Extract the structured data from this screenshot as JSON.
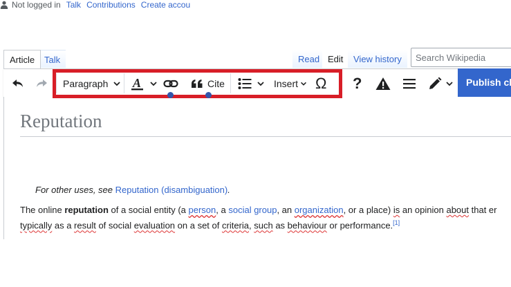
{
  "personal_tools": {
    "status": "Not logged in",
    "talk": "Talk",
    "contributions": "Contributions",
    "create_account": "Create accou"
  },
  "tabs": {
    "article": "Article",
    "talk": "Talk",
    "read": "Read",
    "edit": "Edit",
    "view_history": "View history"
  },
  "search": {
    "placeholder": "Search Wikipedia"
  },
  "toolbar": {
    "undo_icon": "undo-icon",
    "redo_icon": "redo-icon",
    "paragraph": "Paragraph",
    "text_style_icon": "text-style-icon",
    "link_icon": "link-icon",
    "cite": "Cite",
    "list_icon": "bulleted-list-icon",
    "insert": "Insert",
    "special_char": "Ω",
    "help": "?",
    "notice_icon": "warning-icon",
    "menu_icon": "hamburger-icon",
    "edit_mode_icon": "pencil-icon",
    "publish": "Publish ch",
    "highlight_color": "#d81e27",
    "publish_color": "#3366cc"
  },
  "article": {
    "title": "Reputation",
    "hatnote_prefix": "For other uses, see ",
    "hatnote_link": "Reputation (disambiguation)",
    "hatnote_suffix": ".",
    "p1": {
      "t1": "The online ",
      "bold": "reputation",
      "t2": " of a social entity (a ",
      "l1": "person",
      "t3": ", a ",
      "l2": "social group",
      "t4": ", an ",
      "l3": "organization",
      "t5": ", or a place) ",
      "w1": "is",
      "t6": " an opinion ",
      "w2": "about",
      "t7": " that er"
    },
    "p2": {
      "w1": "typically",
      "t1": " as a ",
      "w2": "result",
      "t2": " of social ",
      "w3": "evaluation",
      "t3": " on a set of ",
      "w4": "criteria",
      "t4": ", ",
      "w5": "such",
      "t5": " as ",
      "w6": "behaviour",
      "t6": " or performance.",
      "ref": "[1]"
    }
  }
}
